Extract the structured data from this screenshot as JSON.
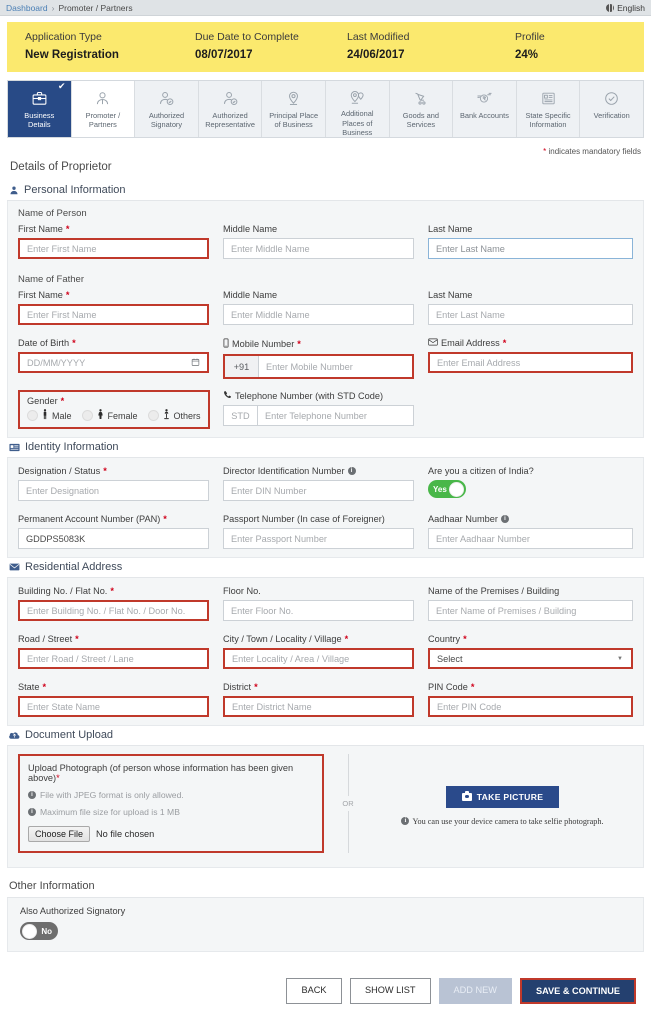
{
  "topbar": {
    "breadcrumb_home": "Dashboard",
    "breadcrumb_sep": "›",
    "breadcrumb_current": "Promoter / Partners",
    "language": "English",
    "globe_icon": "globe-icon"
  },
  "banner": {
    "items": [
      {
        "label": "Application Type",
        "value": "New Registration"
      },
      {
        "label": "Due Date to Complete",
        "value": "08/07/2017"
      },
      {
        "label": "Last Modified",
        "value": "24/06/2017"
      },
      {
        "label": "Profile",
        "value": "24%"
      }
    ]
  },
  "tabs": [
    {
      "label": "Business\nDetails",
      "icon": "briefcase-icon",
      "state": "completed",
      "check": "✔"
    },
    {
      "label": "Promoter /\nPartners",
      "icon": "person-icon",
      "state": "current"
    },
    {
      "label": "Authorized\nSignatory",
      "icon": "person-check-icon",
      "state": "default"
    },
    {
      "label": "Authorized\nRepresentative",
      "icon": "person-check-icon",
      "state": "default"
    },
    {
      "label": "Principal Place\nof Business",
      "icon": "map-pin-icon",
      "state": "default"
    },
    {
      "label": "Additional\nPlaces of\nBusiness",
      "icon": "map-pins-icon",
      "state": "default"
    },
    {
      "label": "Goods and\nServices",
      "icon": "hand-cart-icon",
      "state": "default"
    },
    {
      "label": "Bank Accounts",
      "icon": "rupee-coin-icon",
      "state": "default"
    },
    {
      "label": "State Specific\nInformation",
      "icon": "id-list-icon",
      "state": "default"
    },
    {
      "label": "Verification",
      "icon": "check-circle-icon",
      "state": "default"
    }
  ],
  "mandatory_note": {
    "star": "*",
    "text": "indicates mandatory fields"
  },
  "page_title": "Details of Proprietor",
  "personal_information": {
    "heading": "Personal Information",
    "icon": "user-icon",
    "name_of_person": {
      "subhead": "Name of Person",
      "first_name": {
        "label": "First Name",
        "required": "*",
        "placeholder": "Enter First Name",
        "value": ""
      },
      "middle_name": {
        "label": "Middle Name",
        "required": "",
        "placeholder": "Enter Middle Name",
        "value": ""
      },
      "last_name": {
        "label": "Last Name",
        "required": "",
        "placeholder": "Enter Last Name",
        "value": ""
      }
    },
    "name_of_father": {
      "subhead": "Name of Father",
      "first_name": {
        "label": "First Name",
        "required": "*",
        "placeholder": "Enter First Name",
        "value": ""
      },
      "middle_name": {
        "label": "Middle Name",
        "required": "",
        "placeholder": "Enter Middle Name",
        "value": ""
      },
      "last_name": {
        "label": "Last Name",
        "required": "",
        "placeholder": "Enter Last Name",
        "value": ""
      }
    },
    "date_of_birth": {
      "label": "Date of Birth",
      "required": "*",
      "placeholder": "DD/MM/YYYY",
      "value": "",
      "icon": "calendar-icon"
    },
    "mobile_number": {
      "label": "Mobile Number",
      "required": "*",
      "prefix": "+91",
      "placeholder": "Enter Mobile Number",
      "value": "",
      "icon": "mobile-icon"
    },
    "email_address": {
      "label": "Email Address",
      "required": "*",
      "placeholder": "Enter Email Address",
      "value": "",
      "icon": "envelope-icon"
    },
    "gender": {
      "label": "Gender",
      "required": "*",
      "options": [
        {
          "label": "Male",
          "icon": "male-icon",
          "selected": false
        },
        {
          "label": "Female",
          "icon": "female-icon",
          "selected": false
        },
        {
          "label": "Others",
          "icon": "others-icon",
          "selected": false
        }
      ]
    },
    "telephone_number": {
      "label": "Telephone Number (with STD Code)",
      "required": "",
      "prefix_placeholder": "STD",
      "placeholder": "Enter Telephone Number",
      "value": "",
      "icon": "phone-icon"
    }
  },
  "identity_information": {
    "heading": "Identity Information",
    "icon": "id-card-icon",
    "designation": {
      "label": "Designation / Status",
      "required": "*",
      "placeholder": "Enter Designation",
      "value": ""
    },
    "din": {
      "label": "Director Identification Number",
      "required": "",
      "info": "i",
      "placeholder": "Enter DIN Number",
      "value": ""
    },
    "citizen": {
      "label": "Are you a citizen of India?",
      "toggle_value": "Yes",
      "toggle_state": "on"
    },
    "pan": {
      "label": "Permanent Account Number (PAN)",
      "required": "*",
      "placeholder": "",
      "value": "GDDPS5083K"
    },
    "passport": {
      "label": "Passport Number (In case of Foreigner)",
      "required": "",
      "placeholder": "Enter Passport Number",
      "value": ""
    },
    "aadhaar": {
      "label": "Aadhaar Number",
      "required": "",
      "info": "i",
      "placeholder": "Enter Aadhaar Number",
      "value": ""
    }
  },
  "residential_address": {
    "heading": "Residential Address",
    "icon": "envelope-icon",
    "building_no": {
      "label": "Building No. / Flat No.",
      "required": "*",
      "placeholder": "Enter Building No. / Flat No. / Door No.",
      "value": ""
    },
    "floor_no": {
      "label": "Floor No.",
      "required": "",
      "placeholder": "Enter Floor No.",
      "value": ""
    },
    "premises": {
      "label": "Name of the Premises / Building",
      "required": "",
      "placeholder": "Enter Name of Premises / Building",
      "value": ""
    },
    "road": {
      "label": "Road / Street",
      "required": "*",
      "placeholder": "Enter Road / Street / Lane",
      "value": ""
    },
    "city": {
      "label": "City / Town / Locality / Village",
      "required": "*",
      "placeholder": "Enter Locality / Area / Village",
      "value": ""
    },
    "country": {
      "label": "Country",
      "required": "*",
      "selected": "Select",
      "caret": "▼"
    },
    "state": {
      "label": "State",
      "required": "*",
      "placeholder": "Enter State Name",
      "value": ""
    },
    "district": {
      "label": "District",
      "required": "*",
      "placeholder": "Enter District Name",
      "value": ""
    },
    "pin": {
      "label": "PIN Code",
      "required": "*",
      "placeholder": "Enter PIN Code",
      "value": ""
    }
  },
  "document_upload": {
    "heading": "Document Upload",
    "icon": "cloud-upload-icon",
    "title": "Upload Photograph (of person whose information has been given above)",
    "required": "*",
    "note_format": "File with JPEG format is only allowed.",
    "note_size": "Maximum file size for upload is 1 MB",
    "choose_file_label": "Choose File",
    "file_status": "No file chosen",
    "or_label": "OR",
    "take_picture_label": "TAKE PICTURE",
    "take_picture_icon": "camera-icon",
    "selfie_note": "You can use your device camera to take selfie photograph."
  },
  "other_information": {
    "heading": "Other Information",
    "also_authorized_signatory": {
      "label": "Also Authorized Signatory",
      "toggle_value": "No",
      "toggle_state": "off"
    }
  },
  "footer": {
    "back": "BACK",
    "show_list": "SHOW LIST",
    "add_new": "ADD NEW",
    "save_continue": "SAVE & CONTINUE"
  },
  "colors": {
    "banner_yellow": "#fbe96e",
    "active_tab_blue": "#284a86",
    "primary_button_blue": "#24406f",
    "error_red": "#c0392b",
    "required_star_red": "#d0021b",
    "toggle_on_green": "#49b749",
    "toggle_off_grey": "#6e6e6e",
    "link_blue": "#4a7fb5"
  }
}
